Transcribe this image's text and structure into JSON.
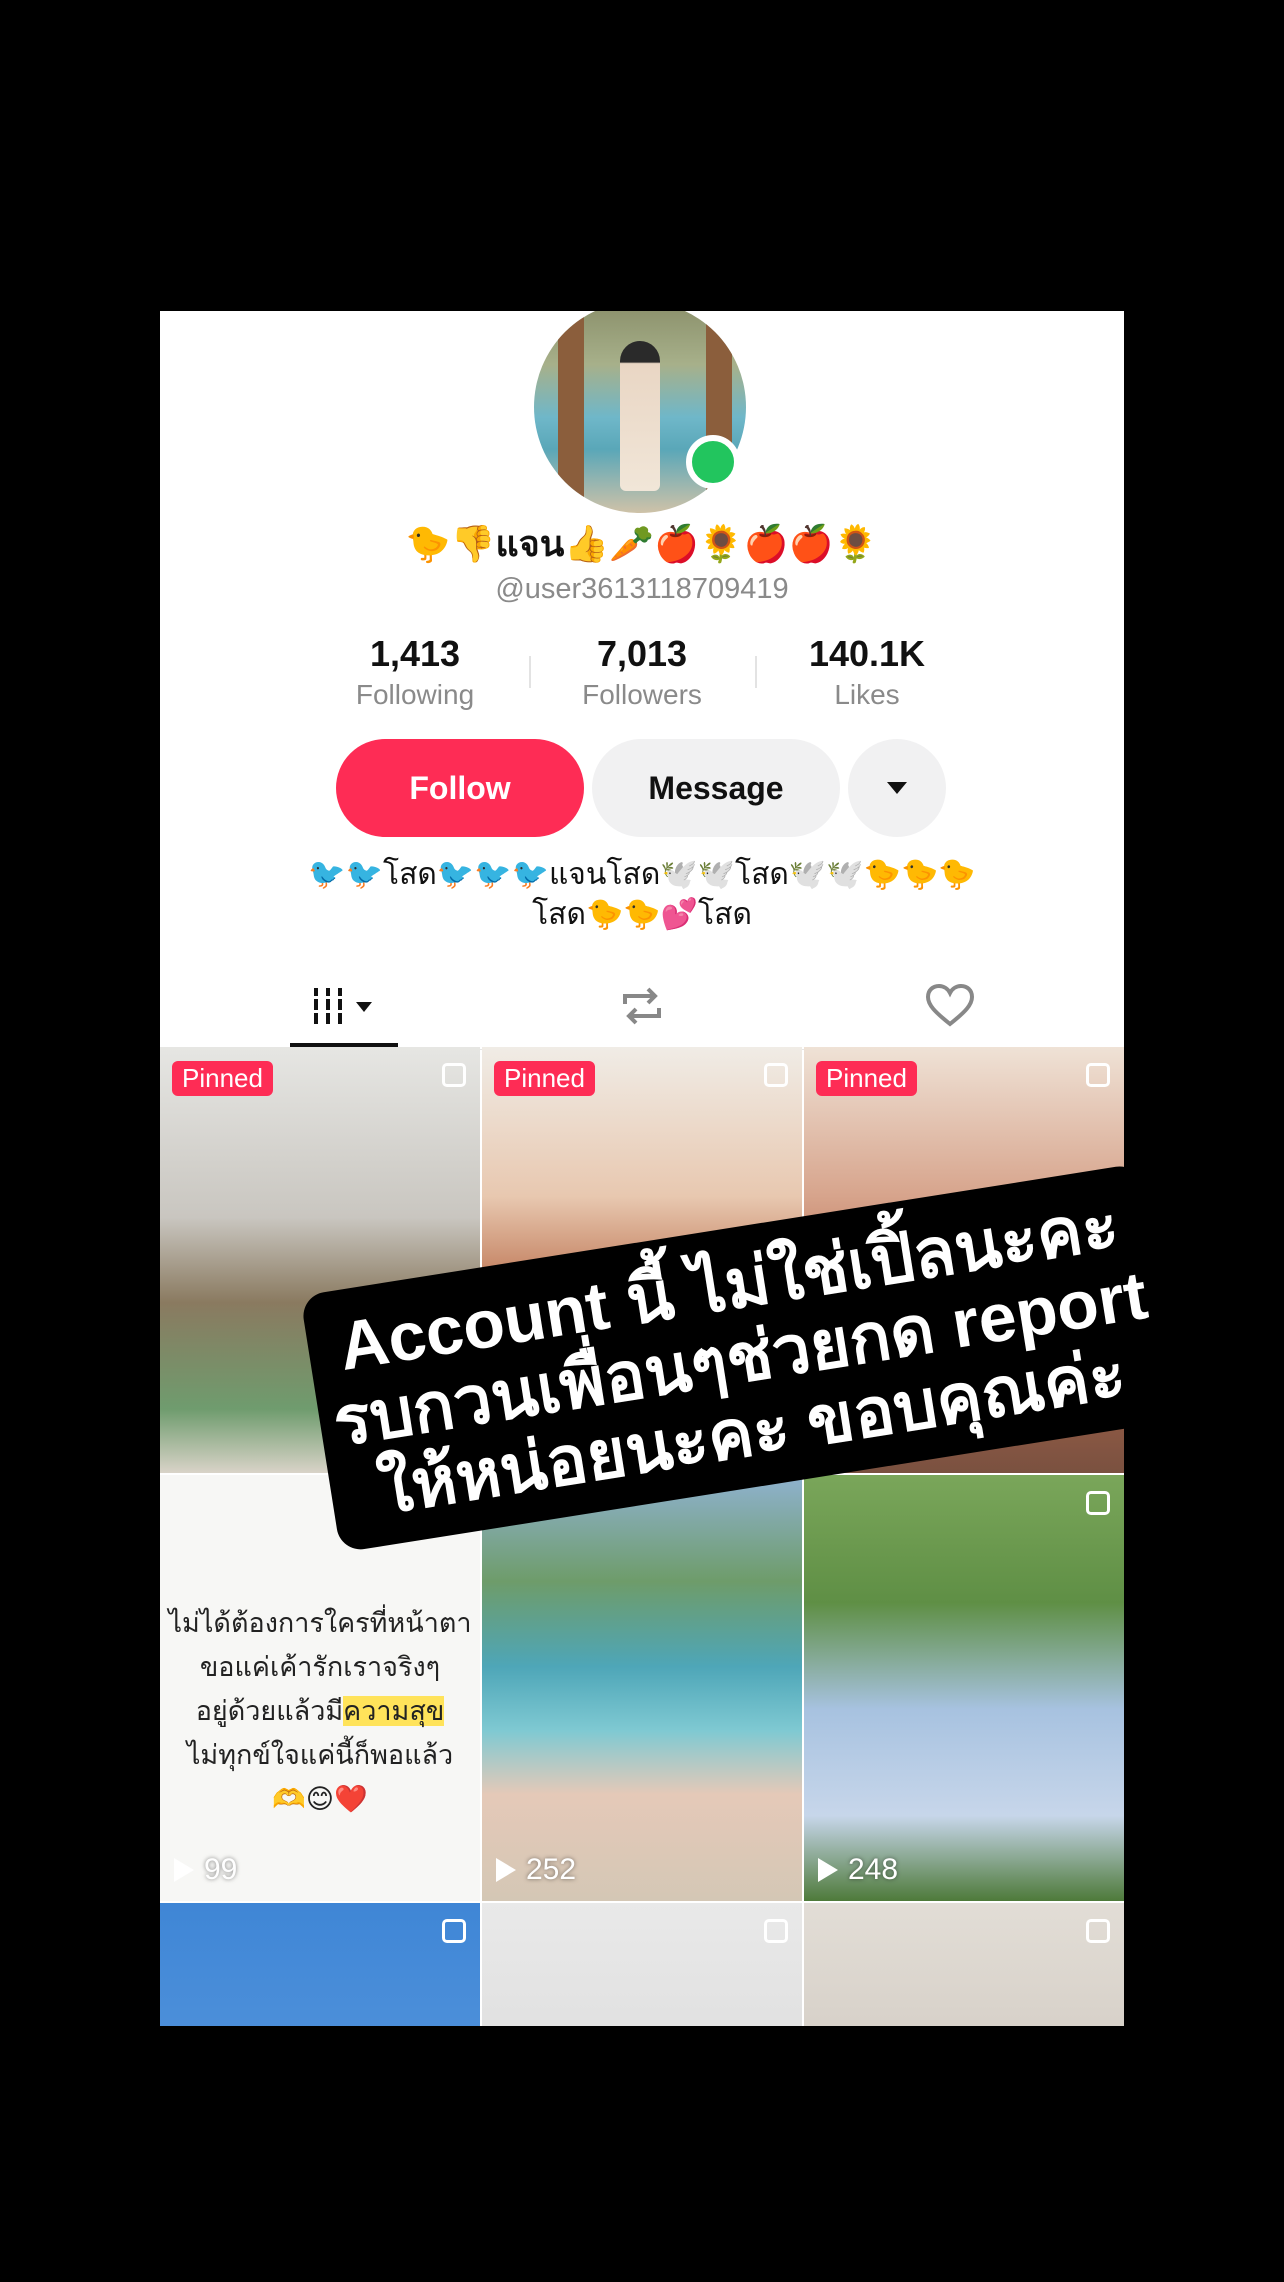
{
  "profile": {
    "display_name": "🐤👎แจน👍🥕🍎🌻🍎🍎🌻",
    "username": "@user3613118709419",
    "stats": [
      {
        "value": "1,413",
        "label": "Following"
      },
      {
        "value": "7,013",
        "label": "Followers"
      },
      {
        "value": "140.1K",
        "label": "Likes"
      }
    ],
    "buttons": {
      "follow": "Follow",
      "message": "Message"
    },
    "bio_line1": "🐦🐦โสด🐦🐦🐦แจนโสด🕊️🕊️โสด🕊️🕊️🐤🐤🐤",
    "bio_line2": "โสด🐤🐤💕โสด"
  },
  "tabs": [
    {
      "name": "videos",
      "icon": "grid-lines-icon",
      "active": true
    },
    {
      "name": "reposts",
      "icon": "repost-icon",
      "active": false
    },
    {
      "name": "liked",
      "icon": "heart-icon",
      "active": false
    }
  ],
  "grid": {
    "pinned_label": "Pinned",
    "row2": [
      {
        "views": "99",
        "text_lines": [
          "ไม่ได้ต้องการใครที่หน้าตา",
          "ขอแค่เค้ารักเราจริงๆ",
          "อยู่ด้วยแล้วมี",
          "ความสุข",
          "ไม่ทุกข์ใจแค่นี้ก็พอแล้ว",
          "🫶😊❤️"
        ]
      },
      {
        "views": "252"
      },
      {
        "views": "248"
      }
    ]
  },
  "caption": {
    "line1": "Account นี้ ไม่ใช่เปิ้ลนะคะ",
    "line2": "รบกวนเพื่อนๆช่วยกด report",
    "line3": "ให้หน่อยนะคะ ขอบคุณค่ะ"
  },
  "colors": {
    "accent": "#fe2c55",
    "online": "#22c55e",
    "secondary_button": "#f1f1f2"
  }
}
